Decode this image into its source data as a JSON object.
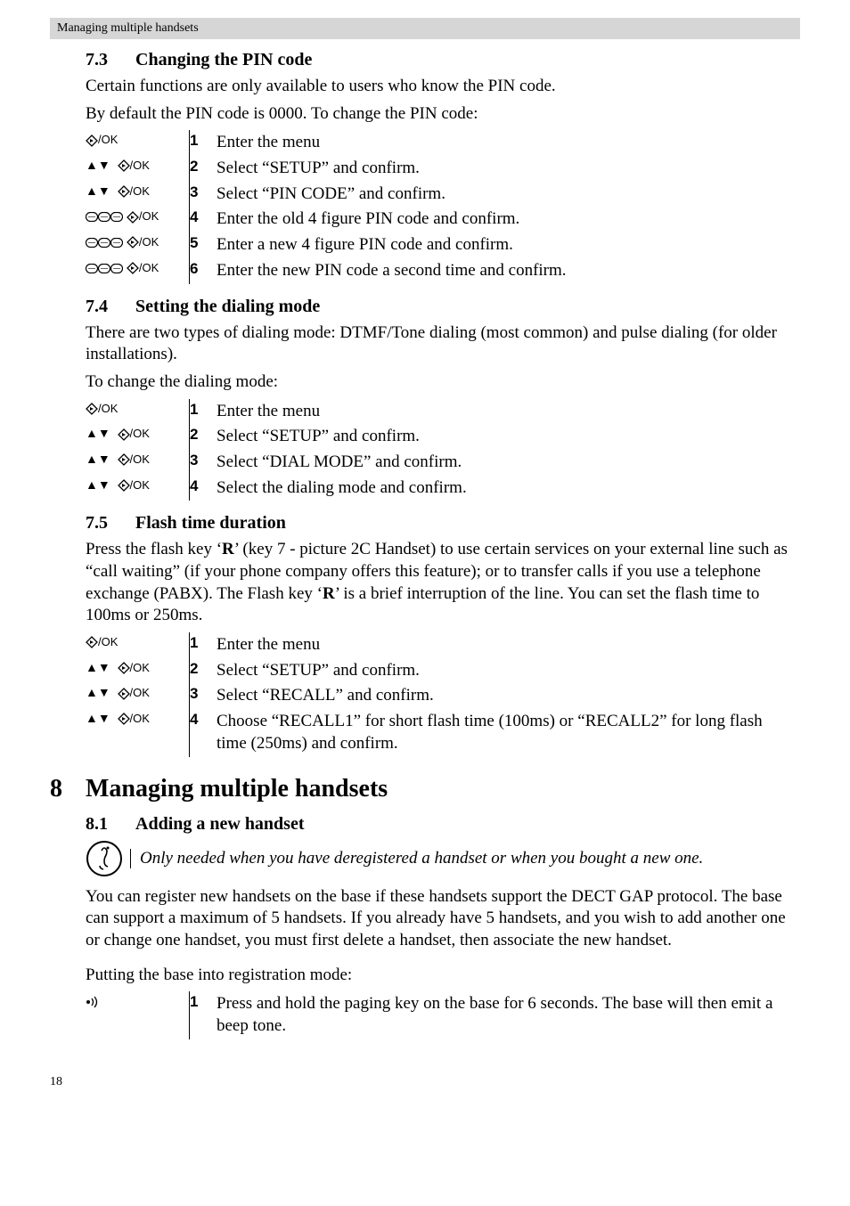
{
  "header": {
    "running": "Managing multiple handsets"
  },
  "sec73": {
    "num": "7.3",
    "title": "Changing the PIN code",
    "intro1": "Certain functions are only available to users who know the PIN code.",
    "intro2": "By default the PIN code is 0000. To change the PIN code:",
    "steps": [
      {
        "icons": "diamond-ok",
        "n": "1",
        "t": "Enter the menu"
      },
      {
        "icons": "updown-diamond-ok",
        "n": "2",
        "t": "Select “SETUP” and confirm."
      },
      {
        "icons": "updown-diamond-ok",
        "n": "3",
        "t": "Select “PIN CODE” and confirm."
      },
      {
        "icons": "keys-diamond-ok",
        "n": "4",
        "t": "Enter the old 4 figure PIN code and confirm."
      },
      {
        "icons": "keys-diamond-ok",
        "n": "5",
        "t": "Enter a new 4 figure PIN code and confirm."
      },
      {
        "icons": "keys-diamond-ok",
        "n": "6",
        "t": "Enter the new PIN code a second time and confirm."
      }
    ]
  },
  "sec74": {
    "num": "7.4",
    "title": "Setting the dialing mode",
    "intro1": "There are two types of dialing mode: DTMF/Tone dialing (most common) and pulse dialing (for older installations).",
    "intro2": "To change the dialing mode:",
    "steps": [
      {
        "icons": "diamond-ok",
        "n": "1",
        "t": "Enter the menu"
      },
      {
        "icons": "updown-diamond-ok",
        "n": "2",
        "t": "Select “SETUP” and confirm."
      },
      {
        "icons": "updown-diamond-ok",
        "n": "3",
        "t": "Select “DIAL MODE” and confirm."
      },
      {
        "icons": "updown-diamond-ok",
        "n": "4",
        "t": "Select the dialing mode and confirm."
      }
    ]
  },
  "sec75": {
    "num": "7.5",
    "title": "Flash time duration",
    "intro": "Press the flash key ‘R’ (key 7 - picture 2C Handset) to use certain services on your external line such as “call waiting” (if your phone company offers this feature); or to transfer calls if you use a telephone exchange (PABX). The Flash key ‘R’ is a brief interruption of the line. You can set the flash time to 100ms or 250ms.",
    "steps": [
      {
        "icons": "diamond-ok",
        "n": "1",
        "t": "Enter the menu"
      },
      {
        "icons": "updown-diamond-ok",
        "n": "2",
        "t": "Select “SETUP” and confirm."
      },
      {
        "icons": "updown-diamond-ok",
        "n": "3",
        "t": "Select “RECALL” and confirm."
      },
      {
        "icons": "updown-diamond-ok",
        "n": "4",
        "t": "Choose “RECALL1” for short flash time (100ms) or “RECALL2” for long flash time (250ms) and confirm."
      }
    ]
  },
  "ch8": {
    "num": "8",
    "title": "Managing multiple handsets"
  },
  "sec81": {
    "num": "8.1",
    "title": "Adding a new handset",
    "note": "Only needed when you have deregistered a handset or when you bought a new one.",
    "p1": "You can register new handsets on the base if these handsets support the DECT GAP protocol. The base can support a maximum of 5 handsets. If you already have 5 handsets, and you wish to add another one or change one handset, you must first delete a handset, then associate the new handset.",
    "p2": "Putting the base into registration mode:",
    "steps": [
      {
        "icons": "paging",
        "n": "1",
        "t": "Press and hold the paging key on the base for 6 seconds. The base will then emit a beep tone."
      }
    ]
  },
  "pagenum": "18",
  "bold_tokens": {
    "R": "R"
  }
}
